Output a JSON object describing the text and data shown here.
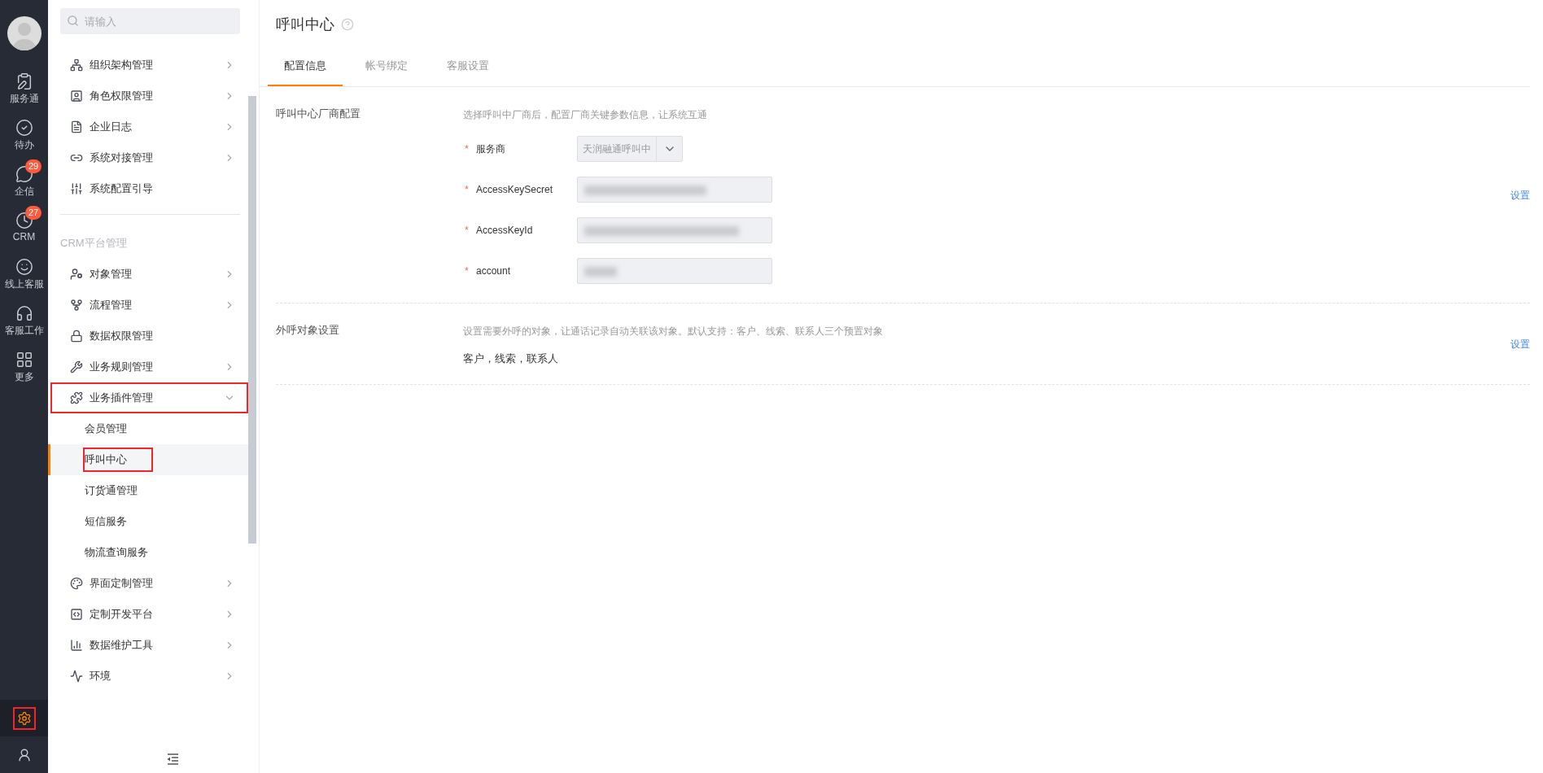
{
  "rail": {
    "items": [
      {
        "label": "服务通"
      },
      {
        "label": "待办"
      },
      {
        "label": "企信",
        "badge": "29"
      },
      {
        "label": "CRM",
        "badge": "27"
      },
      {
        "label": "线上客服"
      },
      {
        "label": "客服工作"
      },
      {
        "label": "更多"
      }
    ],
    "bottom": [
      {
        "selected": true,
        "highlighted": true
      },
      {
        "selected": false,
        "highlighted": false
      }
    ]
  },
  "sidebar": {
    "search": {
      "placeholder": "请输入"
    },
    "groups": [
      {
        "items": [
          {
            "label": "组织架构管理",
            "expandable": true,
            "expanded": false,
            "highlighted": false
          },
          {
            "label": "角色权限管理",
            "expandable": true,
            "expanded": false,
            "highlighted": false
          },
          {
            "label": "企业日志",
            "expandable": true,
            "expanded": false,
            "highlighted": false
          },
          {
            "label": "系统对接管理",
            "expandable": true,
            "expanded": false,
            "highlighted": false
          },
          {
            "label": "系统配置引导",
            "expandable": false,
            "expanded": false,
            "highlighted": false
          }
        ]
      },
      {
        "title": "CRM平台管理",
        "items": [
          {
            "label": "对象管理",
            "expandable": true,
            "expanded": false,
            "highlighted": false
          },
          {
            "label": "流程管理",
            "expandable": true,
            "expanded": false,
            "highlighted": false
          },
          {
            "label": "数据权限管理",
            "expandable": false,
            "expanded": false,
            "highlighted": false
          },
          {
            "label": "业务规则管理",
            "expandable": true,
            "expanded": false,
            "highlighted": false
          },
          {
            "label": "业务插件管理",
            "expandable": true,
            "expanded": true,
            "highlighted": true,
            "children": [
              {
                "label": "会员管理",
                "selected": false,
                "highlighted": false
              },
              {
                "label": "呼叫中心",
                "selected": true,
                "highlighted": true
              },
              {
                "label": "订货通管理",
                "selected": false,
                "highlighted": false
              },
              {
                "label": "短信服务",
                "selected": false,
                "highlighted": false
              },
              {
                "label": "物流查询服务",
                "selected": false,
                "highlighted": false
              }
            ]
          },
          {
            "label": "界面定制管理",
            "expandable": true,
            "expanded": false,
            "highlighted": false
          },
          {
            "label": "定制开发平台",
            "expandable": true,
            "expanded": false,
            "highlighted": false
          },
          {
            "label": "数据维护工具",
            "expandable": true,
            "expanded": false,
            "highlighted": false
          },
          {
            "label": "环境",
            "expandable": true,
            "expanded": false,
            "highlighted": false
          }
        ]
      }
    ]
  },
  "main": {
    "title": "呼叫中心",
    "tabs": [
      {
        "label": "配置信息",
        "selected": true
      },
      {
        "label": "帐号绑定",
        "selected": false
      },
      {
        "label": "客服设置",
        "selected": false
      }
    ],
    "sections": [
      {
        "label": "呼叫中心厂商配置",
        "description": "选择呼叫中厂商后，配置厂商关键参数信息，让系统互通",
        "action": "设置",
        "fields": [
          {
            "label": "服务商",
            "required_mark": "*",
            "kind": "select",
            "value": "天润融通呼叫中"
          },
          {
            "label": "AccessKeySecret",
            "required_mark": "*",
            "kind": "input",
            "masked": true
          },
          {
            "label": "AccessKeyId",
            "required_mark": "*",
            "kind": "input",
            "masked": true
          },
          {
            "label": "account",
            "required_mark": "*",
            "kind": "input",
            "masked": true
          }
        ]
      },
      {
        "label": "外呼对象设置",
        "description": "设置需要外呼的对象，让通话记录自动关联该对象。默认支持：客户、线索、联系人三个预置对象",
        "action": "设置",
        "value": "客户，线索，联系人"
      }
    ]
  }
}
